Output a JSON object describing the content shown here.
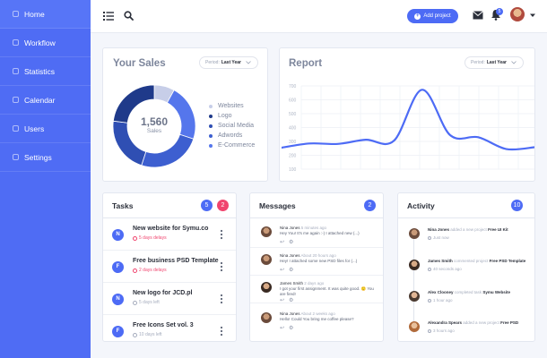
{
  "sidebar": {
    "items": [
      {
        "label": "Home",
        "active": true
      },
      {
        "label": "Workflow"
      },
      {
        "label": "Statistics"
      },
      {
        "label": "Calendar"
      },
      {
        "label": "Users"
      },
      {
        "label": "Settings"
      }
    ]
  },
  "topbar": {
    "add_project_label": "Add project",
    "notification_count": "5"
  },
  "sales": {
    "title": "Your Sales",
    "period_label": "Period:",
    "period_value": "Last Year",
    "total": "1,560",
    "total_label": "Sales",
    "legend": [
      {
        "label": "Websites",
        "color": "#c7cee8"
      },
      {
        "label": "Logo",
        "color": "#1f3a8a"
      },
      {
        "label": "Social Media",
        "color": "#2f4fb3"
      },
      {
        "label": "Adwords",
        "color": "#3d5fd0"
      },
      {
        "label": "E-Commerce",
        "color": "#5576ec"
      }
    ]
  },
  "report": {
    "title": "Report",
    "period_label": "Period:",
    "period_value": "Last Year"
  },
  "chart_data": {
    "type": "line",
    "ylim": [
      100,
      700
    ],
    "y_ticks": [
      "700",
      "600",
      "500",
      "400",
      "300",
      "200",
      "100"
    ],
    "series": [
      {
        "values": [
          255,
          285,
          282,
          312,
          305,
          672,
          345,
          330,
          245,
          258
        ]
      }
    ]
  },
  "tasks": {
    "title": "Tasks",
    "badge_blue": "5",
    "badge_pink": "2",
    "items": [
      {
        "letter": "N",
        "title": "New website for Symu.co",
        "due": "5 days delays",
        "overdue": true
      },
      {
        "letter": "F",
        "title": "Free business PSD Template",
        "due": "2 days delays",
        "overdue": true
      },
      {
        "letter": "N",
        "title": "New logo for JCD.pl",
        "due": "5 days left",
        "overdue": false
      },
      {
        "letter": "F",
        "title": "Free Icons Set vol. 3",
        "due": "10 days left",
        "overdue": false
      }
    ]
  },
  "messages": {
    "title": "Messages",
    "badge": "2",
    "items": [
      {
        "name": "Nina Jones",
        "time": "5 minutes ago",
        "text": "Hey You! It's me again :-) I attached new (...)"
      },
      {
        "name": "Nina Jones",
        "time": "About 20 hours ago",
        "text": "Hey! I attached some new PSD files for (...)"
      },
      {
        "name": "James Smith",
        "time": "2 days ago",
        "text": "I got your first assignment. It was quite good. 🙂 You are fired!"
      },
      {
        "name": "Nina Jones",
        "time": "About 2 weeks ago",
        "text": "Hello! Could You bring me coffee please?"
      }
    ]
  },
  "activity": {
    "title": "Activity",
    "badge": "10",
    "items": [
      {
        "name": "Nina Jones",
        "action": "added a new project",
        "target": "Free UI Kit",
        "time": "Just now"
      },
      {
        "name": "James Smith",
        "action": "commented project",
        "target": "Free PSD Template",
        "time": "40 seconds ago"
      },
      {
        "name": "Alex Clooney",
        "action": "completed task",
        "target": "Symu Website",
        "time": "1 hour ago"
      },
      {
        "name": "Alexandra Spears",
        "action": "added a new project",
        "target": "Free PSD",
        "time": "3 hours ago"
      }
    ]
  }
}
